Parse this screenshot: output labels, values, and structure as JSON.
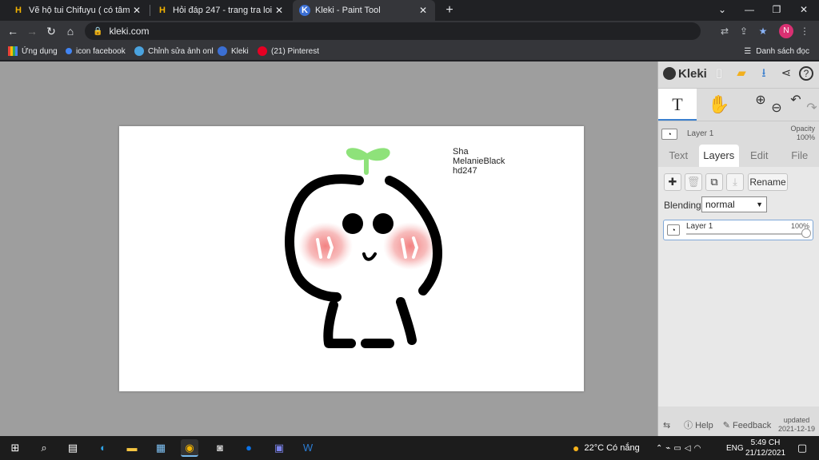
{
  "browser": {
    "tabs": [
      {
        "label": "Vẽ hộ tui Chifuyu ( có tâm nha) M",
        "favicon": "H"
      },
      {
        "label": "Hỏi đáp 247 - trang tra loi",
        "favicon": "H"
      },
      {
        "label": "Kleki - Paint Tool",
        "favicon": "K"
      }
    ],
    "url": "kleki.com",
    "profile_initial": "N"
  },
  "bookmarks": {
    "items": [
      {
        "label": "Ứng dụng",
        "icon": "apps-grid-icon"
      },
      {
        "label": "icon facebook",
        "icon": "facebook-icon"
      },
      {
        "label": "Chỉnh sửa ảnh onl",
        "icon": "photo-edit-icon"
      },
      {
        "label": "Kleki",
        "icon": "kleki-icon"
      },
      {
        "label": "(21) Pinterest",
        "icon": "pinterest-icon"
      }
    ],
    "reading_list": "Danh sách đọc"
  },
  "canvas": {
    "signature": [
      "Sha",
      "MelanieBlack",
      "hd247"
    ]
  },
  "kleki": {
    "logo": "Kleki",
    "layer_name": "Layer 1",
    "opacity_label": "Opacity",
    "opacity_value": "100%",
    "tabs": [
      "Text",
      "Layers",
      "Edit",
      "File"
    ],
    "active_tab": "Layers",
    "rename_label": "Rename",
    "blending_label": "Blending",
    "blending_value": "normal",
    "layer_item": {
      "name": "Layer 1",
      "opacity": "100%"
    },
    "footer": {
      "help": "Help",
      "feedback": "Feedback",
      "updated_label": "updated",
      "updated_date": "2021-12-19"
    }
  },
  "taskbar": {
    "weather": "22°C  Có nắng",
    "language": "ENG",
    "time": "5:49 CH",
    "date": "21/12/2021"
  }
}
